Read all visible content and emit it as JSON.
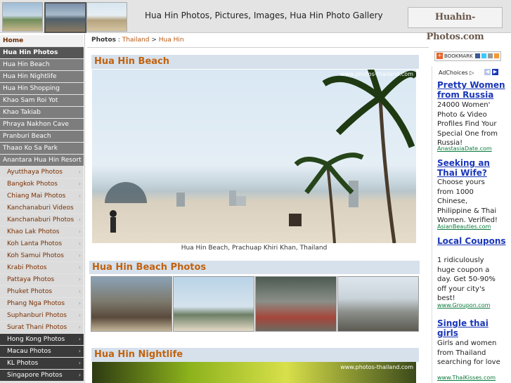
{
  "header": {
    "title": "Hua Hin Photos, Pictures, Images, Hua Hin Photo Gallery",
    "logo_text": "Huahin-Photos.com"
  },
  "nav": {
    "home": "Home",
    "section_title": "Hua Hin Photos",
    "items": [
      "Hua Hin Beach",
      "Hua Hin Nightlife",
      "Hua Hin Shopping",
      "Khao Sam Roi Yot",
      "Khao Takiab",
      "Phraya Nakhon Cave",
      "Pranburi Beach",
      "Thaao Ko Sa Park"
    ],
    "resort": "Anantara Hua Hin Resort",
    "thailand_items": [
      "Ayutthaya Photos",
      "Bangkok Photos",
      "Chiang Mai Photos",
      "Kanchanaburi Videos",
      "Kanchanaburi Photos",
      "Khao Lak Photos",
      "Koh Lanta Photos",
      "Koh Samui Photos",
      "Krabi Photos",
      "Pattaya Photos",
      "Phuket Photos",
      "Phang Nga Photos",
      "Suphanburi Photos",
      "Surat Thani Photos"
    ],
    "other_items": [
      "Hong Kong Photos",
      "Macau Photos",
      "KL Photos",
      "Singapore Photos"
    ]
  },
  "breadcrumb": {
    "label": "Photos",
    "sep1": ":",
    "country": "Thailand",
    "sep2": ">",
    "city": "Hua Hin"
  },
  "main": {
    "section1_title": "Hua Hin Beach",
    "watermark": "www.photos-thailand.com",
    "caption": "Hua Hin Beach, Prachuap Khiri Khan, Thailand",
    "section2_title": "Hua Hin Beach Photos",
    "section3_title": "Hua Hin Nightlife"
  },
  "sidebar": {
    "bookmark_label": "BOOKMARK",
    "adchoices": "AdChoices",
    "ads": [
      {
        "title": "Pretty Women from Russia",
        "body": "24000 Women' Photo & Video Profiles Find Your Special One from Russia!",
        "url": "AnastasiaDate.com"
      },
      {
        "title": "Seeking an Thai Wife?",
        "body": "Choose yours from 1000 Chinese, Philippine & Thai Women. Verified!",
        "url": "AsianBeauties.com"
      },
      {
        "title": "Local Coupons",
        "body": "1 ridiculously huge coupon a day. Get 50-90% off your city's best!",
        "url": "www.Groupon.com"
      },
      {
        "title": "Single thai girls",
        "body": "Girls and women from Thailand searching for love",
        "url": "www.ThaiKisses.com"
      }
    ]
  },
  "colors": {
    "accent": "#c2620e",
    "section_bg": "#d6e1ec",
    "ad_link": "#1a36b8",
    "ad_url": "#0a7a3c"
  }
}
